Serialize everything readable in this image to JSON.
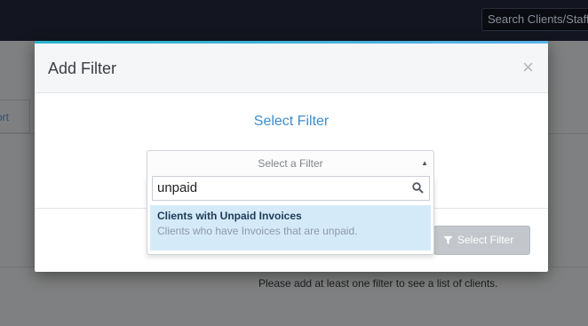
{
  "topbar": {
    "search_placeholder": "Search Clients/Staff..."
  },
  "background": {
    "tab_label": "ort",
    "empty_message": "Please add at least one filter to see a list of clients."
  },
  "modal": {
    "title": "Add Filter",
    "close_glyph": "×",
    "section_title": "Select Filter",
    "select_placeholder": "Select a Filter",
    "search_value": "unpaid",
    "options": [
      {
        "title": "Clients with Unpaid Invoices",
        "description": "Clients who have Invoices that are unpaid."
      }
    ],
    "submit_label": "Select Filter"
  },
  "colors": {
    "accent": "#3e8dc9",
    "topbar": "#131620",
    "highlight": "#d4eaf9"
  },
  "icons": {
    "search": "search-icon",
    "filter": "filter-icon",
    "close": "close-icon",
    "caret": "caret-up-icon"
  }
}
